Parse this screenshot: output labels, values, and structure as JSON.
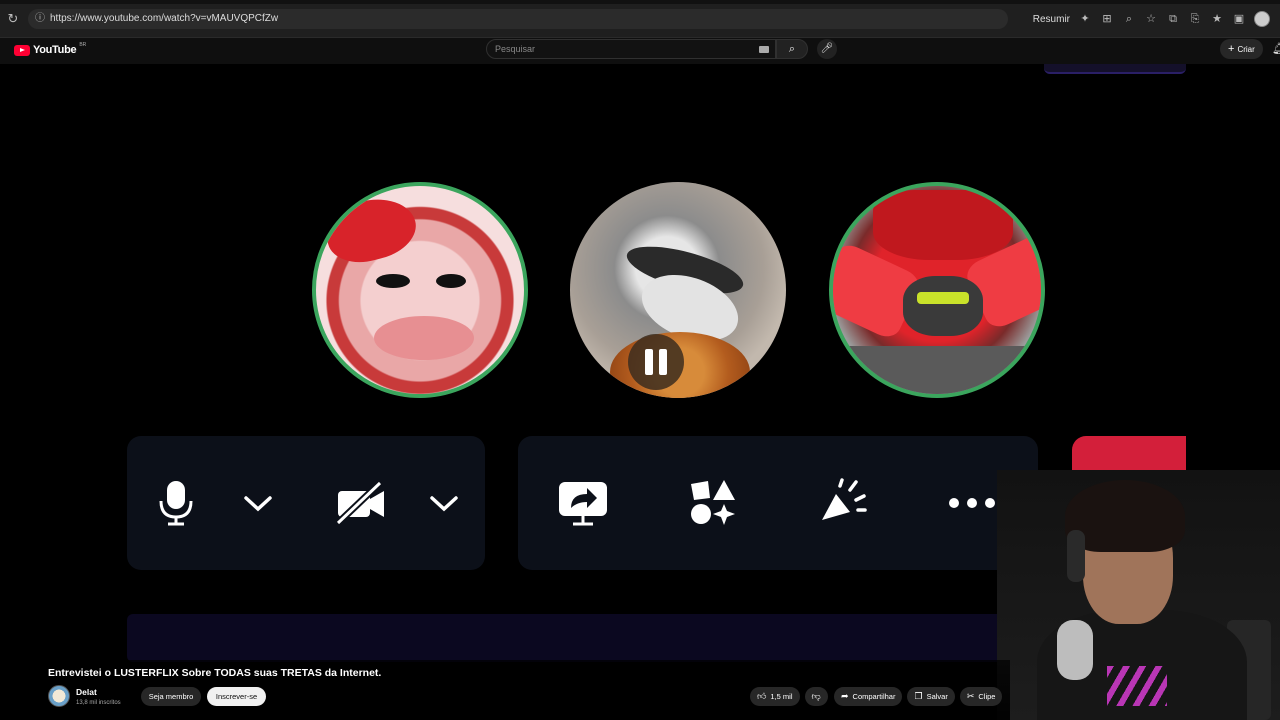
{
  "browser": {
    "url": "https://www.youtube.com/watch?v=vMAUVQPCfZw",
    "summarize_label": "Resumir"
  },
  "youtube": {
    "logo_text": "YouTube",
    "region": "BR",
    "search_placeholder": "Pesquisar",
    "create_label": "Criar"
  },
  "video": {
    "title": "Entrevistei o LUSTERFLIX Sobre TODAS suas TRETAS da Internet.",
    "channel_name": "Delat",
    "subscribers": "13,8 mil inscritos",
    "member_label": "Seja membro",
    "subscribe_label": "Inscrever-se",
    "likes": "1,5 mil",
    "share_label": "Compartilhar",
    "save_label": "Salvar",
    "clip_label": "Clipe"
  },
  "call": {
    "participants": [
      {
        "name": "participant-1",
        "speaking": true
      },
      {
        "name": "participant-2",
        "speaking": false
      },
      {
        "name": "participant-3",
        "speaking": true
      }
    ],
    "speaking_color": "#3ba55d",
    "hangup_color": "#d31f3a"
  },
  "colors": {
    "youtube_red": "#ff0033",
    "subscribe_bg": "#f1f1f1"
  }
}
